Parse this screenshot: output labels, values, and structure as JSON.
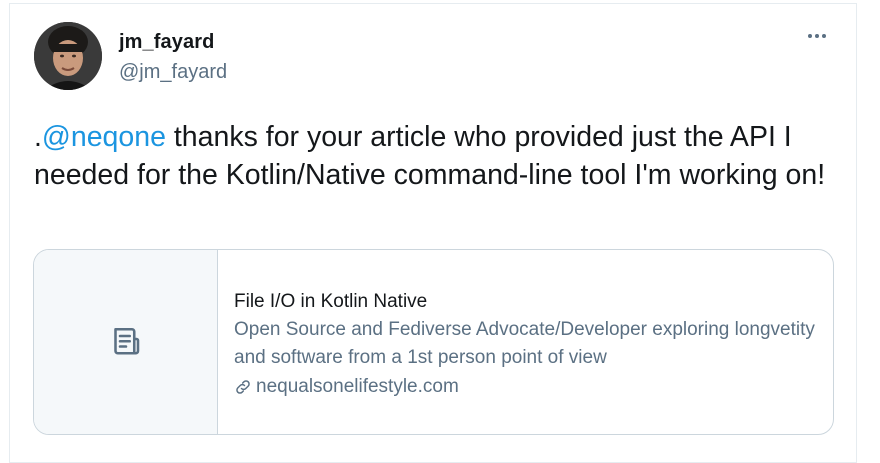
{
  "author": {
    "display_name": "jm_fayard",
    "handle": "@jm_fayard"
  },
  "tweet": {
    "prefix": ".",
    "mention": "@neqone",
    "body": " thanks for your article who provided just the API I needed for the Kotlin/Native command-line tool I'm working on!"
  },
  "card": {
    "title": "File I/O in Kotlin Native",
    "description": "Open Source and Fediverse Advocate/Developer exploring longvetity and software from a 1st person point of view",
    "domain": "nequalsonelifestyle.com",
    "thumb_icon": "document-icon",
    "link_icon": "link-icon"
  },
  "icons": {
    "more": "more-options-icon"
  },
  "colors": {
    "mention": "#1b95e0",
    "secondary_text": "#5b7083",
    "card_border": "#ccd6dd"
  }
}
